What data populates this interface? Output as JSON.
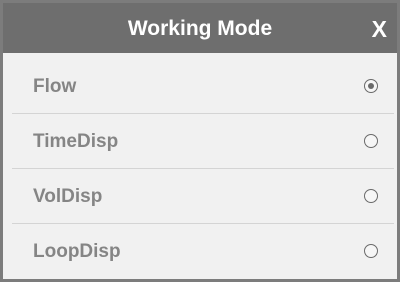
{
  "dialog": {
    "title": "Working Mode",
    "close_label": "X"
  },
  "modes": {
    "selected": "Flow",
    "items": [
      {
        "label": "Flow",
        "checked": true
      },
      {
        "label": "TimeDisp",
        "checked": false
      },
      {
        "label": "VolDisp",
        "checked": false
      },
      {
        "label": "LoopDisp",
        "checked": false
      }
    ]
  },
  "colors": {
    "titlebar": "#6e6e6e",
    "body": "#f1f1f1",
    "label": "#858585",
    "radio": "#6a6a6a"
  }
}
